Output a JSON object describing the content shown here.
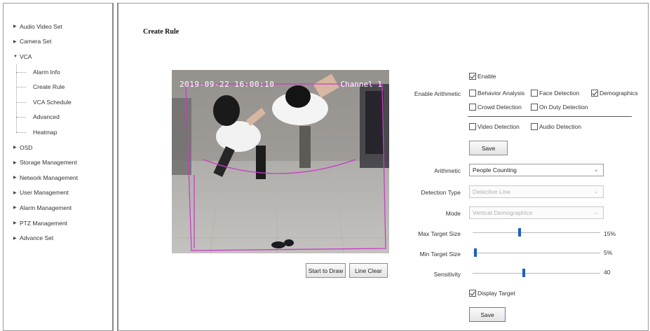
{
  "sidebar": {
    "items": [
      {
        "label": "Audio Video Set",
        "arrow": "▶"
      },
      {
        "label": "Camera Set",
        "arrow": "▶"
      },
      {
        "label": "VCA",
        "arrow": "▼"
      },
      {
        "label": "OSD",
        "arrow": "▶"
      },
      {
        "label": "Storage Management",
        "arrow": "▶"
      },
      {
        "label": "Network Management",
        "arrow": "▶"
      },
      {
        "label": "User Management",
        "arrow": "▶"
      },
      {
        "label": "Alarm Management",
        "arrow": "▶"
      },
      {
        "label": "PTZ Management",
        "arrow": "▶"
      },
      {
        "label": "Advance Set",
        "arrow": "▶"
      }
    ],
    "vca_children": [
      "Alarm Info",
      "Create Rule",
      "VCA Schedule",
      "Advanced",
      "Heatmap"
    ]
  },
  "page": {
    "title": "Create Rule"
  },
  "video": {
    "osd_date": "2019-09-22 16:00:10",
    "osd_channel": "Channel 1"
  },
  "draw_buttons": {
    "start": "Start to Draw",
    "clear": "Line Clear"
  },
  "arithmetic_section": {
    "label": "Enable Arithmetic",
    "enable": {
      "label": "Enable",
      "checked": true
    },
    "options": [
      {
        "label": "Behavior Analysis",
        "checked": false
      },
      {
        "label": "Face Detection",
        "checked": false
      },
      {
        "label": "Demographics",
        "checked": true
      },
      {
        "label": "Crowd Detection",
        "checked": false
      },
      {
        "label": "On Duty Detection",
        "checked": false
      },
      {
        "label": "Video Detection",
        "checked": false
      },
      {
        "label": "Audio Detection",
        "checked": false
      }
    ],
    "save": "Save"
  },
  "fields": {
    "arithmetic": {
      "label": "Arithmetic",
      "value": "People Counting"
    },
    "detection_type": {
      "label": "Detection Type",
      "value": "Detective Line"
    },
    "mode": {
      "label": "Mode",
      "value": "Vertical Demographics"
    }
  },
  "sliders": {
    "max_target": {
      "label": "Max Target Size",
      "value": 15,
      "display": "15%",
      "fraction": 0.37
    },
    "min_target": {
      "label": "Min Target Size",
      "value": 5,
      "display": "5%",
      "fraction": 0.02
    },
    "sensitivity": {
      "label": "Sensitivity",
      "value": 40,
      "display": "40",
      "fraction": 0.4
    }
  },
  "display_target": {
    "label": "Display Target",
    "checked": true
  },
  "save_bottom": "Save",
  "colors": {
    "rule_line": "#c83cc8",
    "slider_thumb": "#1f5fbf"
  }
}
